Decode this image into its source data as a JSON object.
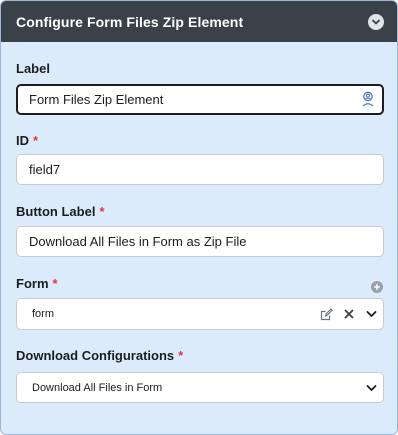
{
  "header": {
    "title": "Configure Form Files Zip Element",
    "collapse_icon": "chevron-down-icon"
  },
  "fields": {
    "label": {
      "label": "Label",
      "value": "Form Files Zip Element",
      "icon": "person-pin-icon"
    },
    "id": {
      "label": "ID",
      "required_marker": "*",
      "value": "field7"
    },
    "button_label": {
      "label": "Button Label",
      "required_marker": "*",
      "value": "Download All Files in Form as Zip File"
    },
    "form": {
      "label": "Form",
      "required_marker": "*",
      "selected": "form",
      "add_icon": "plus-circle-icon",
      "edit_icon": "external-edit-icon",
      "clear_icon": "close-icon",
      "dropdown_icon": "chevron-down-icon"
    },
    "download_config": {
      "label": "Download Configurations",
      "required_marker": "*",
      "selected": "Download All Files in Form",
      "dropdown_icon": "chevron-down-icon"
    }
  },
  "colors": {
    "header_bg": "#3a4149",
    "panel_bg": "#dcebfb",
    "required": "#e0383e",
    "focus_border": "#1d1d1f"
  }
}
